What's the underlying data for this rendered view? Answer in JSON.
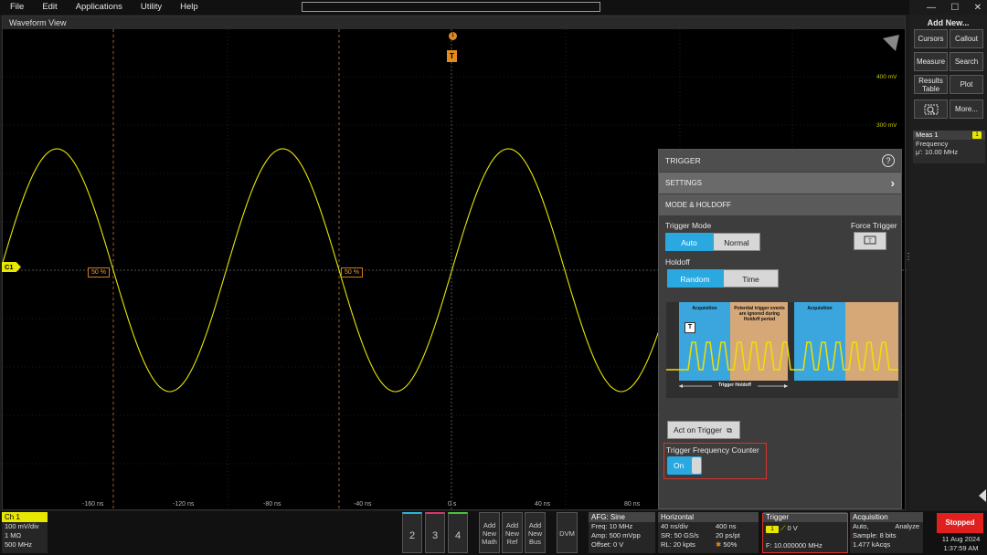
{
  "menu": [
    "File",
    "Edit",
    "Applications",
    "Utility",
    "Help"
  ],
  "window_controls": [
    "—",
    "☐",
    "✕"
  ],
  "waveform": {
    "title": "Waveform View",
    "y_labels": [
      "400 mV",
      "300 mV"
    ],
    "x_labels": [
      "-160 ns",
      "-120 ns",
      "-80 ns",
      "-40 ns",
      "0 s",
      "40 ns",
      "80 ns"
    ],
    "channel_marker": "C1",
    "level_tag": "50 %",
    "trigger_marker": "T",
    "trigger_dot": "1",
    "trace_color": "#e7e700"
  },
  "trigger_panel": {
    "title": "TRIGGER",
    "help_icon": "?",
    "settings": "SETTINGS",
    "mode_holdoff": "MODE & HOLDOFF",
    "trigger_mode_label": "Trigger Mode",
    "mode_options": [
      "Auto",
      "Normal"
    ],
    "mode_selected": "Auto",
    "force_trigger_label": "Force Trigger",
    "holdoff_label": "Holdoff",
    "holdoff_options": [
      "Random",
      "Time"
    ],
    "holdoff_selected": "Random",
    "diagram": {
      "acq1": "Acquisition",
      "ignored": "Potential trigger events are ignored during Holdoff period",
      "acq2": "Acquisition",
      "holdoff": "Trigger Holdoff",
      "marker": "T"
    },
    "act_on_trigger": "Act on Trigger",
    "freq_counter_label": "Trigger Frequency Counter",
    "freq_counter_state": "On"
  },
  "sidebar": {
    "title": "Add New...",
    "buttons": [
      "Cursors",
      "Callout",
      "Measure",
      "Search",
      "Results Table",
      "Plot",
      "",
      "More..."
    ],
    "meas": {
      "title": "Meas 1",
      "badge": "1",
      "name": "Frequency",
      "value": "μ': 10.00 MHz"
    }
  },
  "bottom": {
    "ch1": {
      "title": "Ch 1",
      "lines": [
        "100 mV/div",
        "1 MΩ",
        "500 MHz"
      ]
    },
    "channels": [
      "2",
      "3",
      "4"
    ],
    "adds": [
      [
        "Add",
        "New",
        "Math"
      ],
      [
        "Add",
        "New",
        "Ref"
      ],
      [
        "Add",
        "New",
        "Bus"
      ]
    ],
    "dvm": "DVM",
    "afg": {
      "title": "AFG: Sine",
      "lines": [
        "Freq: 10 MHz",
        "Amp: 500 mVpp",
        "Offset: 0 V"
      ]
    },
    "horizontal": {
      "title": "Horizontal",
      "col1": [
        "40 ns/div",
        "SR: 50 GS/s",
        "RL: 20 kpts"
      ],
      "col2": [
        "400 ns",
        "20 ps/pt",
        "50%"
      ]
    },
    "trigger": {
      "title": "Trigger",
      "badge": "1",
      "level": "0 V",
      "freq": "F: 10.000000 MHz"
    },
    "acquisition": {
      "title": "Acquisition",
      "lines": [
        "Auto,",
        "Sample: 8 bits",
        "1.477 kAcqs"
      ],
      "analyze": "Analyze"
    },
    "status": "Stopped",
    "date": "11 Aug 2024",
    "time": "1:37:59 AM"
  }
}
